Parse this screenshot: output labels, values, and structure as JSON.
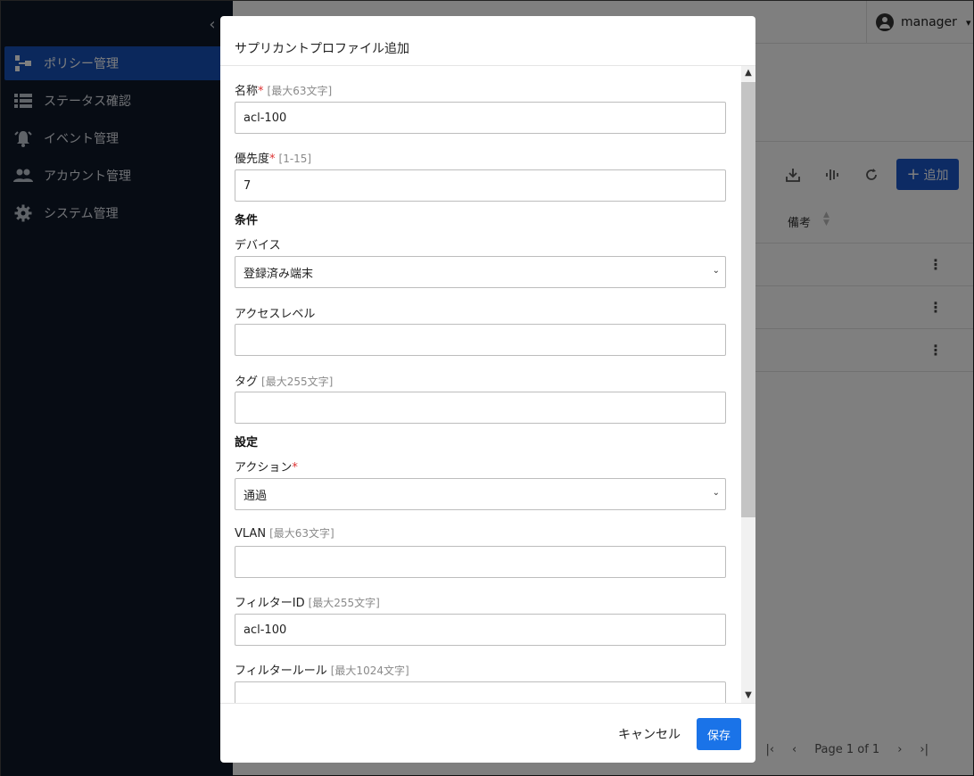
{
  "sidebar": {
    "items": [
      {
        "label": "ポリシー管理",
        "icon": "policy-tree-icon",
        "active": true
      },
      {
        "label": "ステータス確認",
        "icon": "list-icon",
        "active": false
      },
      {
        "label": "イベント管理",
        "icon": "alarm-icon",
        "active": false
      },
      {
        "label": "アカウント管理",
        "icon": "people-icon",
        "active": false
      },
      {
        "label": "システム管理",
        "icon": "gear-icon",
        "active": false
      }
    ]
  },
  "header": {
    "user_name": "manager"
  },
  "toolbar": {
    "add_label": "追加"
  },
  "table": {
    "columns": [
      "備考"
    ],
    "row_count": 3
  },
  "pagination": {
    "label": "Page 1 of 1"
  },
  "modal": {
    "title": "サプリカントプロファイル追加",
    "fields": {
      "name": {
        "label": "名称",
        "required": true,
        "hint": "[最大63文字]",
        "value": "acl-100"
      },
      "priority": {
        "label": "優先度",
        "required": true,
        "hint": "[1-15]",
        "value": "7"
      },
      "condition_section": "条件",
      "device": {
        "label": "デバイス",
        "value": "登録済み端末"
      },
      "access_level": {
        "label": "アクセスレベル",
        "value": ""
      },
      "tag": {
        "label": "タグ",
        "hint": "[最大255文字]",
        "value": ""
      },
      "settings_section": "設定",
      "action": {
        "label": "アクション",
        "required": true,
        "value": "通過"
      },
      "vlan": {
        "label": "VLAN",
        "hint": "[最大63文字]",
        "value": ""
      },
      "filter_id": {
        "label": "フィルターID",
        "hint": "[最大255文字]",
        "value": "acl-100"
      },
      "filter_rule": {
        "label": "フィルタールール",
        "hint": "[最大1024文字]",
        "value": ""
      }
    },
    "cancel_label": "キャンセル",
    "save_label": "保存"
  },
  "colors": {
    "sidebar_bg": "#0f1829",
    "accent": "#1a56c9",
    "primary_button": "#1a73e8"
  }
}
